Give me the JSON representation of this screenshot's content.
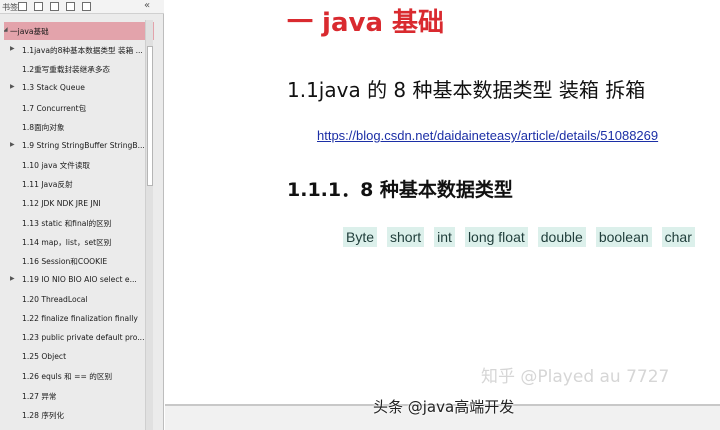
{
  "toolbar": {
    "panel_label": "书签",
    "icons": [
      "bookmark-list-icon",
      "expand-icon",
      "collapse-icon",
      "export-icon",
      "bookmark-add-icon"
    ],
    "close_label": "«"
  },
  "outline": {
    "root": "一java基础",
    "items": [
      {
        "label": "1.1java的8种基本数据类型 装箱 ...",
        "expandable": true
      },
      {
        "label": "1.2重写重载封装继承多态",
        "expandable": false
      },
      {
        "label": "1.3 Stack Queue",
        "expandable": true
      },
      {
        "label": "1.7 Concurrent包",
        "expandable": false
      },
      {
        "label": "1.8面向对象",
        "expandable": false
      },
      {
        "label": "1.9 String StringBuffer StringB...",
        "expandable": true
      },
      {
        "label": "1.10 java 文件读取",
        "expandable": false
      },
      {
        "label": "1.11 Java反射",
        "expandable": false
      },
      {
        "label": "1.12 JDK NDK JRE JNI",
        "expandable": false
      },
      {
        "label": "1.13 static 和final的区别",
        "expandable": false
      },
      {
        "label": "1.14 map，list，set区别",
        "expandable": false
      },
      {
        "label": "1.16 Session和COOKIE",
        "expandable": false
      },
      {
        "label": "1.19 IO NIO  BIO AIO select e...",
        "expandable": true
      },
      {
        "label": "1.20 ThreadLocal",
        "expandable": false
      },
      {
        "label": "1.22 finalize finalization finally",
        "expandable": false
      },
      {
        "label": "1.23 public private default pro...",
        "expandable": false
      },
      {
        "label": "1.25 Object",
        "expandable": false
      },
      {
        "label": "1.26 equls 和 == 的区别",
        "expandable": false
      },
      {
        "label": "1.27 异常",
        "expandable": false
      },
      {
        "label": "1.28 序列化",
        "expandable": false
      }
    ]
  },
  "document": {
    "h1": "一 java 基础",
    "h2": "1.1java 的 8 种基本数据类型  装箱  拆箱",
    "link": "https://blog.csdn.net/daidaineteasy/article/details/51088269",
    "h3": "1.1.1．8 种基本数据类型",
    "types": [
      "Byte",
      "short",
      "int",
      "long float",
      "double",
      "boolean",
      "char"
    ]
  },
  "overlay": {
    "watermark": "知乎 @Played  au  7727",
    "credit": "头条 @java高端开发"
  },
  "colors": {
    "heading_red": "#d92a2f",
    "link_blue": "#1c2fa6",
    "chip_bg": "#dcf0eb",
    "root_highlight": "#e3a3ab"
  }
}
